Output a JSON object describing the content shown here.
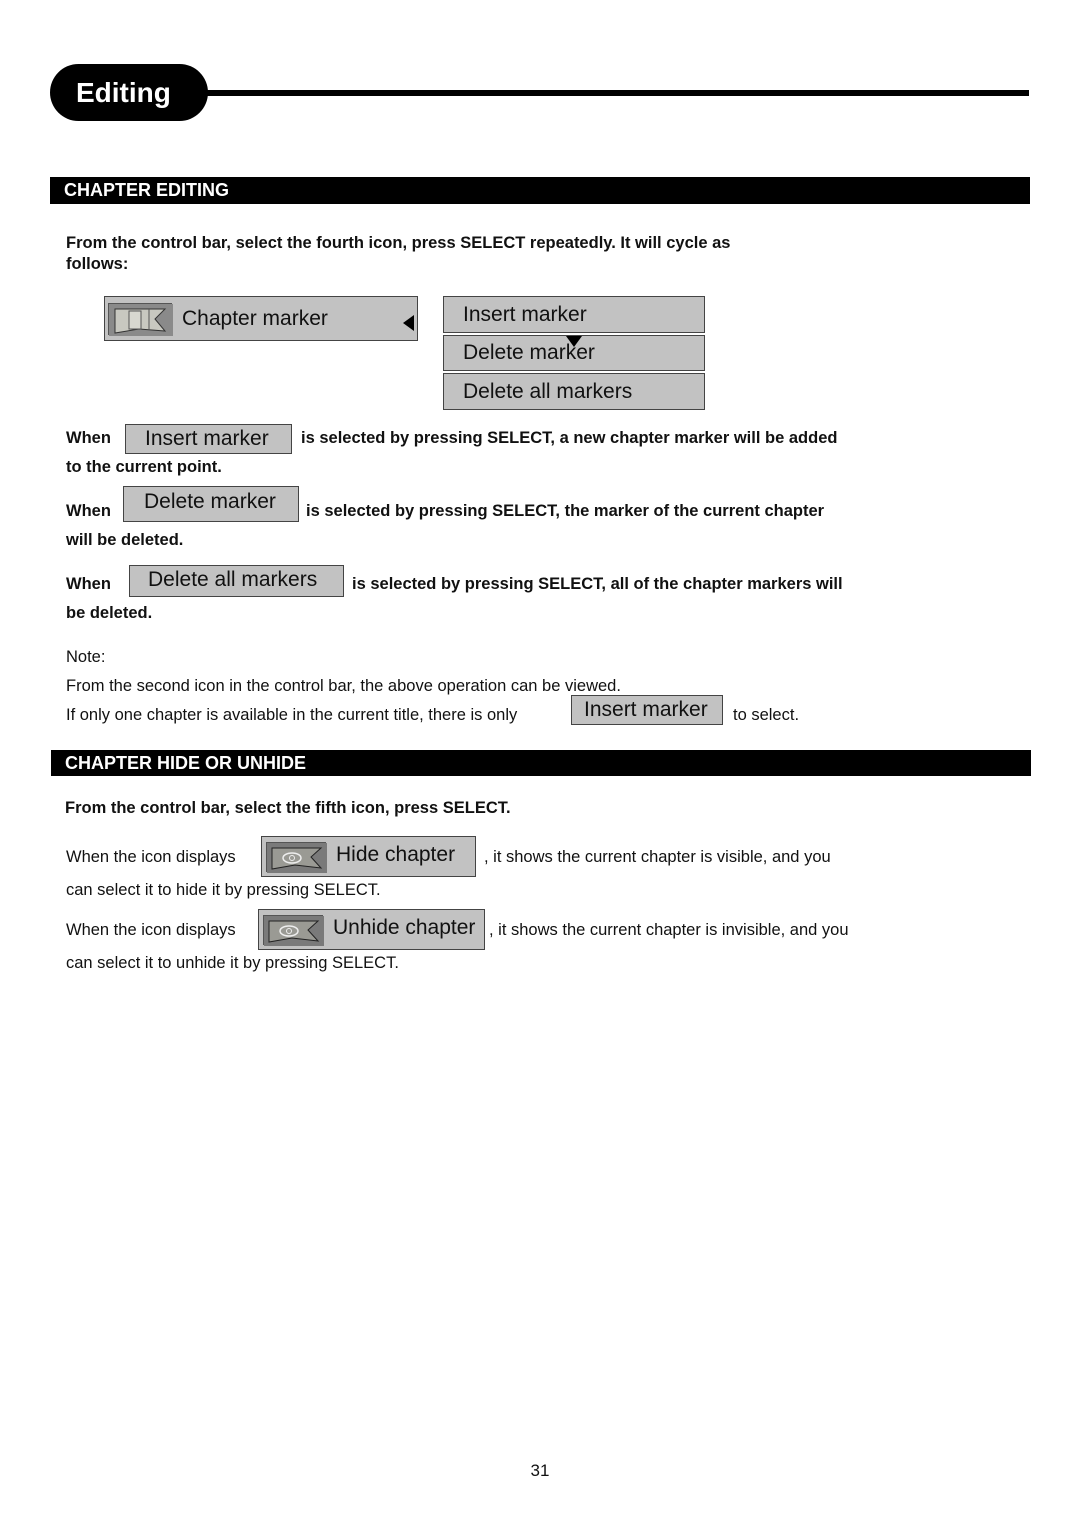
{
  "page": {
    "title": "Editing",
    "page_number": "31"
  },
  "chapter_editing": {
    "heading": "CHAPTER EDITING",
    "intro_line1": "From the control bar, select the fourth icon, press SELECT repeatedly. It will cycle as",
    "intro_line2": "follows:",
    "osd_main": {
      "label": "Chapter marker",
      "icon": "chapter-flag-icon",
      "arrow": "left-arrow-icon"
    },
    "menu_items": [
      {
        "label": "Insert marker"
      },
      {
        "label": "Delete marker"
      },
      {
        "label": "Delete all markers"
      }
    ],
    "descriptions": [
      {
        "when": "When",
        "button": "Insert marker",
        "rest": "is selected by pressing SELECT, a new chapter marker will be added",
        "line2": "to the current  point."
      },
      {
        "when": "When",
        "button": "Delete marker",
        "rest": "is selected by pressing SELECT, the marker of the current chapter",
        "line2": "will be deleted."
      },
      {
        "when": "When",
        "button": "Delete all markers",
        "rest": "is selected by pressing SELECT, all of the chapter markers will",
        "line2": "be deleted."
      }
    ],
    "note": {
      "label": "Note:",
      "line1": "From the second icon in the control bar, the above operation can be viewed.",
      "line2_pre": "If only one chapter is available in the current title, there is only",
      "line2_button": "Insert marker",
      "line2_post": "to select."
    }
  },
  "chapter_hide": {
    "heading": "CHAPTER HIDE OR UNHIDE",
    "intro": "From the control bar, select the fifth icon, press SELECT.",
    "items": [
      {
        "pre": "When the icon displays",
        "button": "Hide chapter",
        "post": ", it shows the current chapter is visible, and you",
        "line2": "can select it to hide it by pressing SELECT."
      },
      {
        "pre": "When the icon displays",
        "button": "Unhide chapter",
        "post": ", it shows the current chapter is invisible, and you",
        "line2": "can select it to unhide it by pressing SELECT."
      }
    ]
  }
}
